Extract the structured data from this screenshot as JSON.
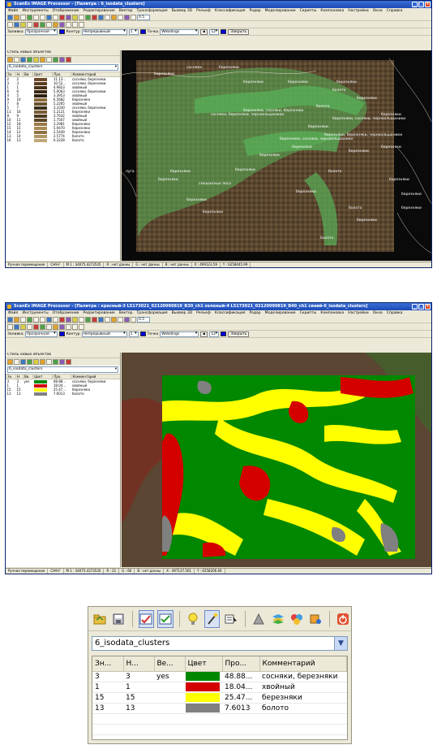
{
  "win1": {
    "title": "ScanEx IMAGE Processor - [Палитра : 6_isodata_clusters]",
    "menus": [
      "Файл",
      "Инструменты",
      "Отображение",
      "Редактирование",
      "Вектор",
      "Трансформация",
      "Вьювер 3D",
      "Рельеф",
      "Классификация",
      "Радар",
      "Моделирование",
      "Скрипты",
      "Компоновка",
      "Настройки",
      "Окна",
      "Справка"
    ],
    "zoom_value": "0.5",
    "prop": {
      "fill_label": "Заливка",
      "fill_value": "Прозрачная",
      "contour_label": "Контур",
      "contour_value": "Непрерывный",
      "contour_width": "1",
      "point_label": "Точка",
      "point_value": "Webdings",
      "point_size": "12",
      "close_label": "Закрыть"
    },
    "layer_label": "Стиль новых объектов",
    "palette_combo": "6_isodata_clusters",
    "columns": [
      "Зн.",
      "Н.",
      "Ви.",
      "Цвет",
      "Про.",
      "Комментарий"
    ],
    "rows": [
      {
        "zn": "2",
        "n": "2",
        "color": "#6b4a2a",
        "pr": "11.13...",
        "comment": "сосняки, березняки"
      },
      {
        "zn": "3",
        "n": "3",
        "color": "#5a3c1e",
        "pr": "10.52...",
        "comment": "сосняки, березняки"
      },
      {
        "zn": "1",
        "n": "1",
        "color": "#4a3218",
        "pr": "4.9823",
        "comment": "хвойный"
      },
      {
        "zn": "6",
        "n": "6",
        "color": "#3a2812",
        "pr": "5.0063",
        "comment": "сосняки, березняки"
      },
      {
        "zn": "4",
        "n": "5",
        "color": "#2e2010",
        "pr": "3.3953",
        "comment": "хвойный"
      },
      {
        "zn": "9",
        "n": "10",
        "color": "#8a6a3a",
        "pr": "6.5682",
        "comment": "березняки"
      },
      {
        "zn": "7",
        "n": "8",
        "color": "#6a5230",
        "pr": "5.2265",
        "comment": "хвойный"
      },
      {
        "zn": "5",
        "n": "7",
        "color": "#3c2e18",
        "pr": "3.3330",
        "comment": "сосняки, березняки"
      },
      {
        "zn": "11",
        "n": "16",
        "color": "#7a5c34",
        "pr": "5.2121",
        "comment": "березняки"
      },
      {
        "zn": "8",
        "n": "9",
        "color": "#4e3a20",
        "pr": "3.7632",
        "comment": "хвойный"
      },
      {
        "zn": "10",
        "n": "11",
        "color": "#5e4626",
        "pr": "1.7507",
        "comment": "хвойный"
      },
      {
        "zn": "12",
        "n": "18",
        "color": "#9a7a48",
        "pr": "3.2981",
        "comment": "березняки"
      },
      {
        "zn": "15",
        "n": "15",
        "color": "#a88a56",
        "pr": "5.9470",
        "comment": "березняки"
      },
      {
        "zn": "14",
        "n": "12",
        "color": "#8e7244",
        "pr": "2.5449",
        "comment": "березняки"
      },
      {
        "zn": "13",
        "n": "14",
        "color": "#b09866",
        "pr": "2.5774",
        "comment": "болото"
      },
      {
        "zn": "16",
        "n": "13",
        "color": "#c0a878",
        "pr": "0.3228",
        "comment": "болото"
      }
    ],
    "map_labels": [
      "березняки",
      "сосняки",
      "березняки",
      "березняки",
      "березняки",
      "болото",
      "березняки",
      "березняки",
      "березняки",
      "березняки",
      "болото",
      "березняки",
      "березняки",
      "болото",
      "березняки",
      "березняки",
      "березняки",
      "болото",
      "березняки",
      "болото",
      "луга",
      "березняки",
      "березняки",
      "смешанные леса",
      "березняки",
      "березняки",
      "березняки",
      "березняки",
      "березняки, сосняки, черноольшаники",
      "сосняки, березняки, черноольшаники",
      "березняки, сосняки, березняки",
      "березняки, сосняки, черноольшаники",
      "березняки, березняки, черноольшаники",
      "березняки",
      "березняки"
    ],
    "status": [
      "Ручное перемещение",
      "CH9-F",
      "M 1 : 34075.4273535",
      "R : нет данны",
      "G : нет данны",
      "B : нет данны",
      "X : 499123.59",
      "Y : 6258445.99"
    ]
  },
  "win2": {
    "title": "ScanEx IMAGE Processor - [Палитра : красный-3 L5173021_02120090819_B30_ch1 зеленый-4 L5173021_02120090819_B40_ch1 синий-6_isodata_clusters]",
    "menus": [
      "Файл",
      "Инструменты",
      "Отображение",
      "Редактирование",
      "Вектор",
      "Трансформация",
      "Вьювер 3D",
      "Рельеф",
      "Классификация",
      "Радар",
      "Моделирование",
      "Скрипты",
      "Компоновка",
      "Настройки",
      "Окна",
      "Справка"
    ],
    "zoom_value": "0.5",
    "prop": {
      "fill_label": "Заливка",
      "fill_value": "Прозрачная",
      "contour_label": "Контур",
      "contour_value": "Непрерывный",
      "contour_width": "1",
      "point_label": "Точка",
      "point_value": "Webdings",
      "point_size": "12",
      "close_label": "Закрыть"
    },
    "layer_label": "Стиль новых объектов",
    "palette_combo": "6_isodata_clusters",
    "columns": [
      "Зн.",
      "Н.",
      "Ви.",
      "Цвет",
      "Про.",
      "Комментарий"
    ],
    "rows": [
      {
        "zn": "3",
        "n": "3",
        "vi": "yes",
        "color": "#008800",
        "pr": "48.88...",
        "comment": "сосняки, березняки"
      },
      {
        "zn": "1",
        "n": "1",
        "vi": "",
        "color": "#d40000",
        "pr": "18.04...",
        "comment": "хвойный"
      },
      {
        "zn": "15",
        "n": "15",
        "vi": "",
        "color": "#ffff00",
        "pr": "25.47...",
        "comment": "березняки"
      },
      {
        "zn": "13",
        "n": "13",
        "vi": "",
        "color": "#808080",
        "pr": "7.6013",
        "comment": "болото"
      }
    ],
    "status": [
      "Ручное перемещение",
      "CH9-F",
      "M 1 : 34075.4273535",
      "R : 21",
      "G : 66",
      "B : нет данны",
      "X : 497137.561",
      "Y : 6258206.66"
    ]
  },
  "palette": {
    "icons": [
      "open-folder-icon",
      "save-icon",
      "edit-table-icon",
      "check-icon",
      "bulb-icon",
      "wand-icon",
      "table-select-icon",
      "cone-icon",
      "layers-icon",
      "palette-icon",
      "color-fill-icon",
      "power-icon"
    ],
    "combo": "6_isodata_clusters",
    "columns": [
      "Зн...",
      "Н...",
      "Ве...",
      "Цвет",
      "Про...",
      "Комментарий"
    ],
    "rows": [
      {
        "zn": "3",
        "n": "3",
        "ve": "yes",
        "color": "#008800",
        "pr": "48.88...",
        "comment": "сосняки, березняки"
      },
      {
        "zn": "1",
        "n": "1",
        "ve": "",
        "color": "#d40000",
        "pr": "18.04...",
        "comment": "хвойный"
      },
      {
        "zn": "15",
        "n": "15",
        "ve": "",
        "color": "#ffff00",
        "pr": "25.47...",
        "comment": "березняки"
      },
      {
        "zn": "13",
        "n": "13",
        "ve": "",
        "color": "#808080",
        "pr": "7.6013",
        "comment": "болото"
      }
    ]
  }
}
